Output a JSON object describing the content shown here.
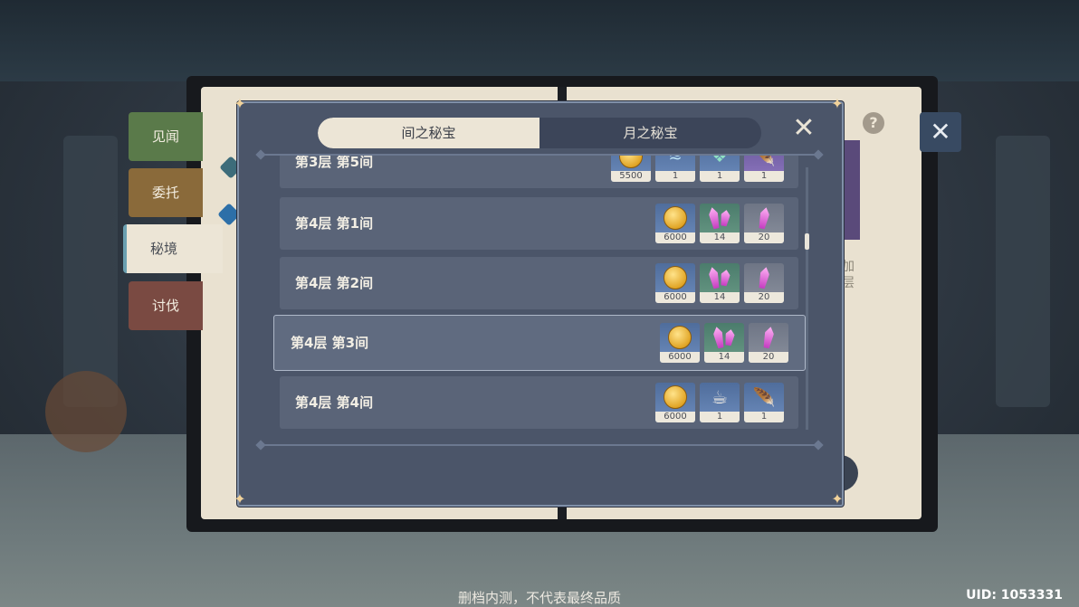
{
  "side_tabs": [
    {
      "label": "见闻",
      "color": "#5a7a4a"
    },
    {
      "label": "委托",
      "color": "#8a6a3a"
    },
    {
      "label": "秘境",
      "color": "#ece5d6"
    },
    {
      "label": "讨伐",
      "color": "#7a4a42"
    }
  ],
  "right_page_text": [
    "加",
    "层"
  ],
  "modal": {
    "tabs": {
      "active": "间之秘宝",
      "inactive": "月之秘宝"
    },
    "rows": [
      {
        "label": "第3层 第5间",
        "rewards": [
          {
            "icon": "mora-coin-icon",
            "quality": "blue",
            "count": "5500"
          },
          {
            "icon": "fatui-mask-icon",
            "quality": "blue",
            "count": "1"
          },
          {
            "icon": "artifact-icon",
            "quality": "blue",
            "count": "1"
          },
          {
            "icon": "feather-artifact-icon",
            "quality": "purple",
            "count": "1"
          }
        ]
      },
      {
        "label": "第4层 第1间",
        "rewards": [
          {
            "icon": "mora-coin-icon",
            "quality": "blue",
            "count": "6000"
          },
          {
            "icon": "enhancement-ore-icon",
            "quality": "green",
            "count": "14"
          },
          {
            "icon": "enhancement-ore-small-icon",
            "quality": "gray",
            "count": "20"
          }
        ]
      },
      {
        "label": "第4层 第2间",
        "rewards": [
          {
            "icon": "mora-coin-icon",
            "quality": "blue",
            "count": "6000"
          },
          {
            "icon": "enhancement-ore-icon",
            "quality": "green",
            "count": "14"
          },
          {
            "icon": "enhancement-ore-small-icon",
            "quality": "gray",
            "count": "20"
          }
        ]
      },
      {
        "label": "第4层 第3间",
        "selected": true,
        "rewards": [
          {
            "icon": "mora-coin-icon",
            "quality": "blue",
            "count": "6000"
          },
          {
            "icon": "enhancement-ore-icon",
            "quality": "green",
            "count": "14"
          },
          {
            "icon": "enhancement-ore-small-icon",
            "quality": "gray",
            "count": "20"
          }
        ]
      },
      {
        "label": "第4层 第4间",
        "rewards": [
          {
            "icon": "mora-coin-icon",
            "quality": "blue",
            "count": "6000"
          },
          {
            "icon": "teacup-icon",
            "quality": "blue",
            "count": "1"
          },
          {
            "icon": "feather-artifact-icon",
            "quality": "blue",
            "count": "1"
          }
        ]
      }
    ]
  },
  "footer": {
    "note": "删档内测，不代表最终品质",
    "uid": "UID: 1053331"
  }
}
